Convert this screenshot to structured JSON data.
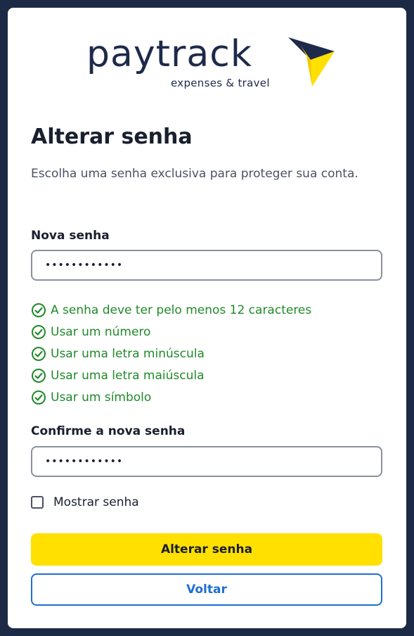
{
  "brand": {
    "name": "paytrack",
    "tagline": "expenses & travel"
  },
  "page": {
    "title": "Alterar senha",
    "subtitle": "Escolha uma senha exclusiva para proteger sua conta."
  },
  "new_password": {
    "label": "Nova senha",
    "value": "••••••••••••"
  },
  "rules": [
    {
      "text": "A senha deve ter pelo menos 12 caracteres",
      "satisfied": true
    },
    {
      "text": "Usar um número",
      "satisfied": true
    },
    {
      "text": "Usar uma letra minúscula",
      "satisfied": true
    },
    {
      "text": "Usar uma letra maiúscula",
      "satisfied": true
    },
    {
      "text": "Usar um símbolo",
      "satisfied": true
    }
  ],
  "confirm_password": {
    "label": "Confirme a nova senha",
    "value": "••••••••••••"
  },
  "show_password": {
    "label": "Mostrar senha",
    "checked": false
  },
  "buttons": {
    "submit_label": "Alterar senha",
    "back_label": "Voltar"
  },
  "colors": {
    "background": "#1c2a45",
    "accent_yellow": "#ffe000",
    "success_green": "#1f8a2a",
    "link_blue": "#1f6fd1",
    "brand_navy": "#1e2a4a"
  }
}
